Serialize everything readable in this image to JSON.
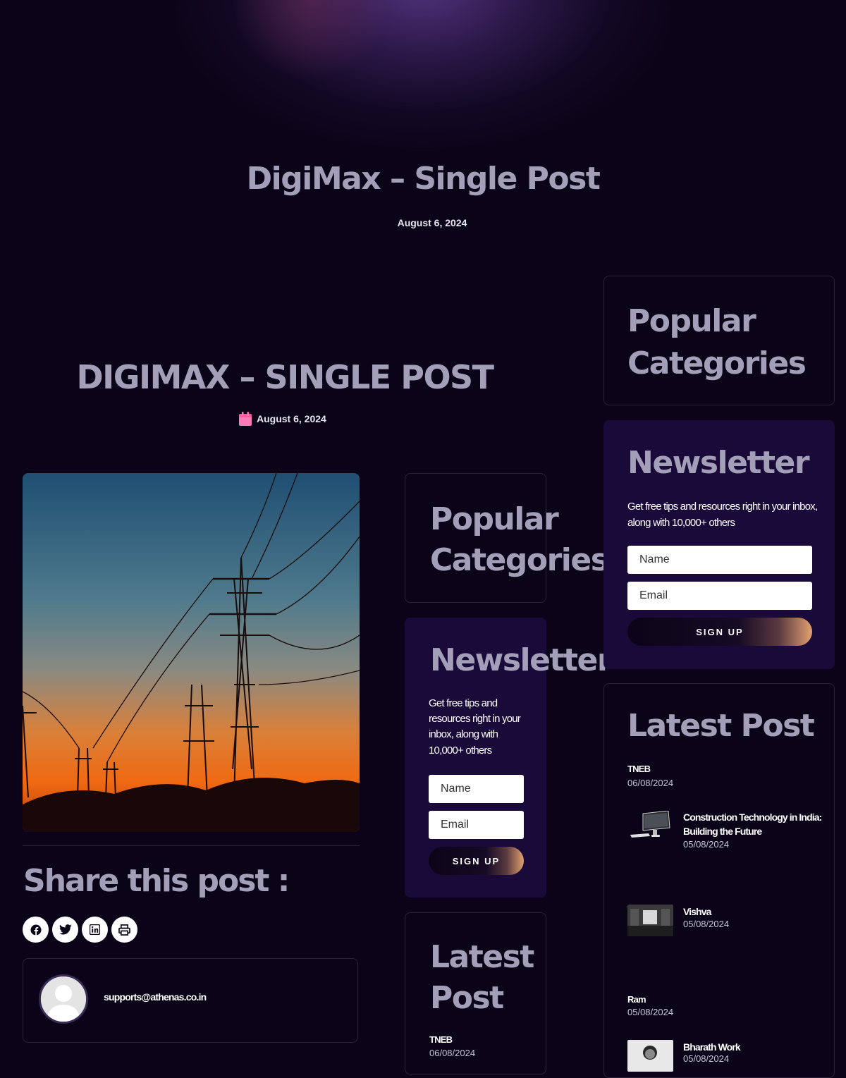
{
  "hero": {
    "title": "DigiMax – Single Post",
    "date": "August 6, 2024"
  },
  "post": {
    "title": "DIGIMAX – SINGLE POST",
    "date": "August 6, 2024",
    "featured_image": "transmission-towers-sunset"
  },
  "share": {
    "title": "Share this post :",
    "buttons": [
      "facebook-icon",
      "twitter-icon",
      "linkedin-icon",
      "print-icon"
    ]
  },
  "author": {
    "email": "supports@athenas.co.in"
  },
  "sidebar": {
    "categories_title": "Popular Categories",
    "newsletter": {
      "title": "Newsletter",
      "description": "Get free tips and resources right in your inbox, along with 10,000+ others",
      "name_placeholder": "Name",
      "email_placeholder": "Email",
      "signup_label": "SIGN UP"
    },
    "latest_title": "Latest Post",
    "latest_posts": [
      {
        "name": "TNEB",
        "date": "06/08/2024"
      },
      {
        "title": "Construction Technology in India: Building the Future",
        "date": "05/08/2024"
      },
      {
        "title": "Vishva",
        "date": "05/08/2024"
      },
      {
        "name": "Ram",
        "date": "05/08/2024"
      },
      {
        "title": "Bharath Work",
        "date": "05/08/2024"
      }
    ]
  },
  "colors": {
    "background": "#0b0418",
    "heading": "#a39fb8",
    "newsletter_bg": "#1a0a3a",
    "accent": "#ff7ab6"
  }
}
